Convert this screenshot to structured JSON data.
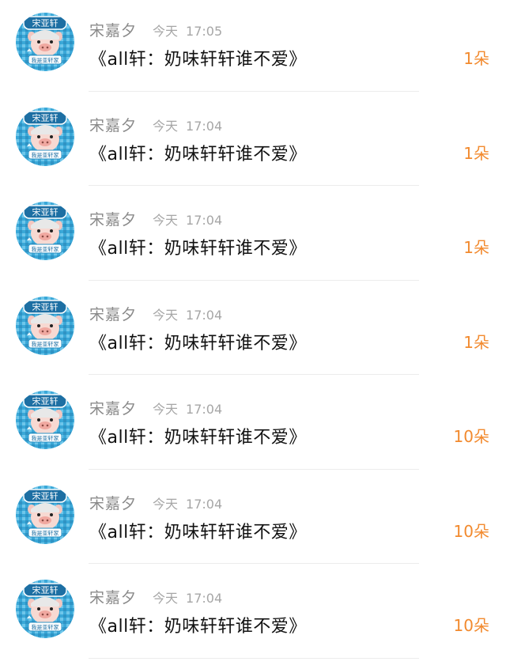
{
  "colors": {
    "count_accent": "#f28a2e",
    "username": "#8a8a8a",
    "timestamp": "#a6a6a6",
    "message": "#111111"
  },
  "avatar": {
    "icon": "cartoon-pig-avatar-icon",
    "badge_text": "宋亚轩",
    "sign_text": "我是亚轩家"
  },
  "items": [
    {
      "username": "宋嘉夕",
      "date": "今天",
      "time": "17:05",
      "message": "《all轩：奶味轩轩谁不爱》",
      "count": "1朵"
    },
    {
      "username": "宋嘉夕",
      "date": "今天",
      "time": "17:04",
      "message": "《all轩：奶味轩轩谁不爱》",
      "count": "1朵"
    },
    {
      "username": "宋嘉夕",
      "date": "今天",
      "time": "17:04",
      "message": "《all轩：奶味轩轩谁不爱》",
      "count": "1朵"
    },
    {
      "username": "宋嘉夕",
      "date": "今天",
      "time": "17:04",
      "message": "《all轩：奶味轩轩谁不爱》",
      "count": "1朵"
    },
    {
      "username": "宋嘉夕",
      "date": "今天",
      "time": "17:04",
      "message": "《all轩：奶味轩轩谁不爱》",
      "count": "10朵"
    },
    {
      "username": "宋嘉夕",
      "date": "今天",
      "time": "17:04",
      "message": "《all轩：奶味轩轩谁不爱》",
      "count": "10朵"
    },
    {
      "username": "宋嘉夕",
      "date": "今天",
      "time": "17:04",
      "message": "《all轩：奶味轩轩谁不爱》",
      "count": "10朵"
    }
  ]
}
